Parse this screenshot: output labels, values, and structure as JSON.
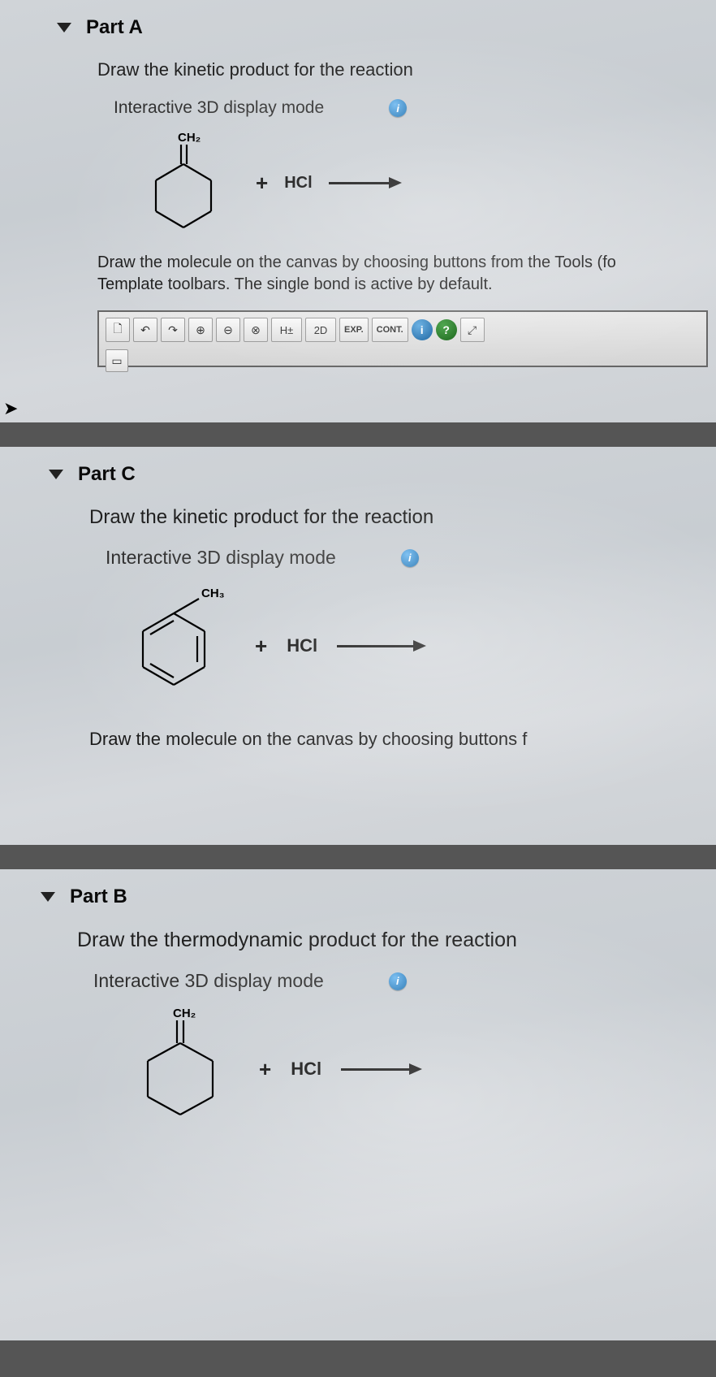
{
  "parts": {
    "a": {
      "title": "Part A",
      "prompt": "Draw the kinetic product for the reaction",
      "mode": "Interactive 3D display mode",
      "info": "i",
      "substituent": "CH₂",
      "plus": "+",
      "reagent": "HCl",
      "instr": "Draw the molecule on the canvas by choosing buttons from the Tools (fo\nTemplate toolbars. The single bond is active by default."
    },
    "c": {
      "title": "Part C",
      "prompt": "Draw the kinetic product for the reaction",
      "mode": "Interactive 3D display mode",
      "info": "i",
      "substituent": "CH₃",
      "plus": "+",
      "reagent": "HCl",
      "instr": "Draw the molecule on the canvas by choosing buttons f"
    },
    "b": {
      "title": "Part B",
      "prompt": "Draw the thermodynamic product for the reaction",
      "mode": "Interactive 3D display mode",
      "info": "i",
      "substituent": "CH₂",
      "plus": "+",
      "reagent": "HCl"
    }
  },
  "toolbar": {
    "new": "🗋",
    "undo": "↶",
    "redo": "↷",
    "zoomin": "⊕",
    "zoomout": "⊖",
    "close": "⊗",
    "h": "H±",
    "twod": "2D",
    "exp": "EXP.",
    "cont": "CONT.",
    "info": "i",
    "help": "?",
    "full": "⤢"
  }
}
